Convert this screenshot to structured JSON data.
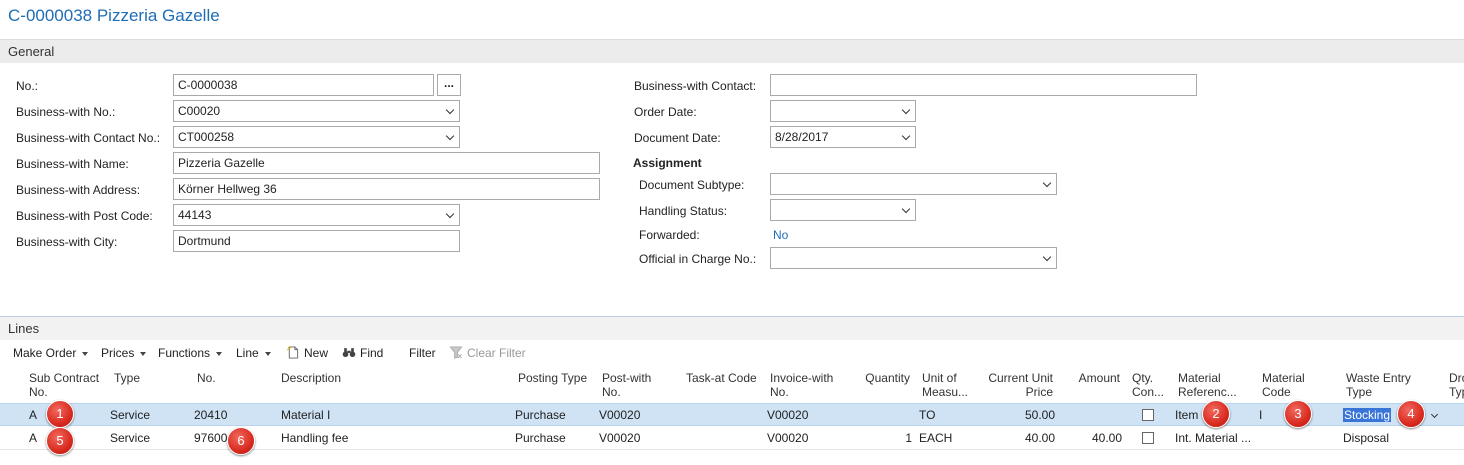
{
  "title": "C-0000038 Pizzeria Gazelle",
  "general": {
    "section": "General",
    "no_label": "No.:",
    "no_value": "C-0000038",
    "ellipsis": "...",
    "bw_no_label": "Business-with No.:",
    "bw_no_value": "C00020",
    "bw_contact_no_label": "Business-with Contact No.:",
    "bw_contact_no_value": "CT000258",
    "bw_name_label": "Business-with Name:",
    "bw_name_value": "Pizzeria Gazelle",
    "bw_address_label": "Business-with Address:",
    "bw_address_value": "Körner Hellweg 36",
    "bw_post_code_label": "Business-with Post Code:",
    "bw_post_code_value": "44143",
    "bw_city_label": "Business-with City:",
    "bw_city_value": "Dortmund",
    "bw_contact_label": "Business-with Contact:",
    "bw_contact_value": "",
    "order_date_label": "Order Date:",
    "order_date_value": "",
    "document_date_label": "Document Date:",
    "document_date_value": "8/28/2017",
    "assignment_heading": "Assignment",
    "doc_subtype_label": "Document Subtype:",
    "doc_subtype_value": "",
    "handling_status_label": "Handling Status:",
    "handling_status_value": "",
    "forwarded_label": "Forwarded:",
    "forwarded_value": "No",
    "official_label": "Official in Charge No.:",
    "official_value": ""
  },
  "lines": {
    "section": "Lines",
    "toolbar": {
      "make_order": "Make Order",
      "prices": "Prices",
      "functions": "Functions",
      "line": "Line",
      "new": "New",
      "find": "Find",
      "filter": "Filter",
      "clear_filter": "Clear Filter"
    },
    "columns": {
      "sub_contract_1": "Sub Contract",
      "sub_contract_2": "No.",
      "type": "Type",
      "no": "No.",
      "description": "Description",
      "posting_type": "Posting Type",
      "post_with_1": "Post-with",
      "post_with_2": "No.",
      "task_at_code": "Task-at Code",
      "invoice_with_1": "Invoice-with",
      "invoice_with_2": "No.",
      "quantity": "Quantity",
      "uom_1": "Unit of",
      "uom_2": "Measu...",
      "unit_price_1": "Current Unit",
      "unit_price_2": "Price",
      "amount": "Amount",
      "qty_con_1": "Qty.",
      "qty_con_2": "Con...",
      "material_ref_1": "Material",
      "material_ref_2": "Referenc...",
      "material_code_1": "Material",
      "material_code_2": "Code",
      "waste_entry_1": "Waste Entry",
      "waste_entry_2": "Type",
      "dro_1": "Dro",
      "dro_2": "Typ"
    },
    "rows": [
      {
        "sub_contract": "A",
        "type": "Service",
        "no": "20410",
        "description": "Material I",
        "posting_type": "Purchase",
        "post_with": "V00020",
        "task_at": "",
        "invoice_with": "V00020",
        "quantity": "",
        "uom": "TO",
        "unit_price": "50.00",
        "amount": "",
        "material_ref": "Item",
        "material_code": "I",
        "waste_entry": "Stocking"
      },
      {
        "sub_contract": "A",
        "type": "Service",
        "no": "97600",
        "description": "Handling fee",
        "posting_type": "Purchase",
        "post_with": "V00020",
        "task_at": "",
        "invoice_with": "V00020",
        "quantity": "1",
        "uom": "EACH",
        "unit_price": "40.00",
        "amount": "40.00",
        "material_ref": "Int. Material ...",
        "material_code": "",
        "waste_entry": "Disposal"
      }
    ]
  },
  "badges": [
    "1",
    "2",
    "3",
    "4",
    "5",
    "6"
  ],
  "colors": {
    "title": "#1f6db5",
    "selected_row": "#cfe3f5",
    "badge": "#d92b20"
  }
}
